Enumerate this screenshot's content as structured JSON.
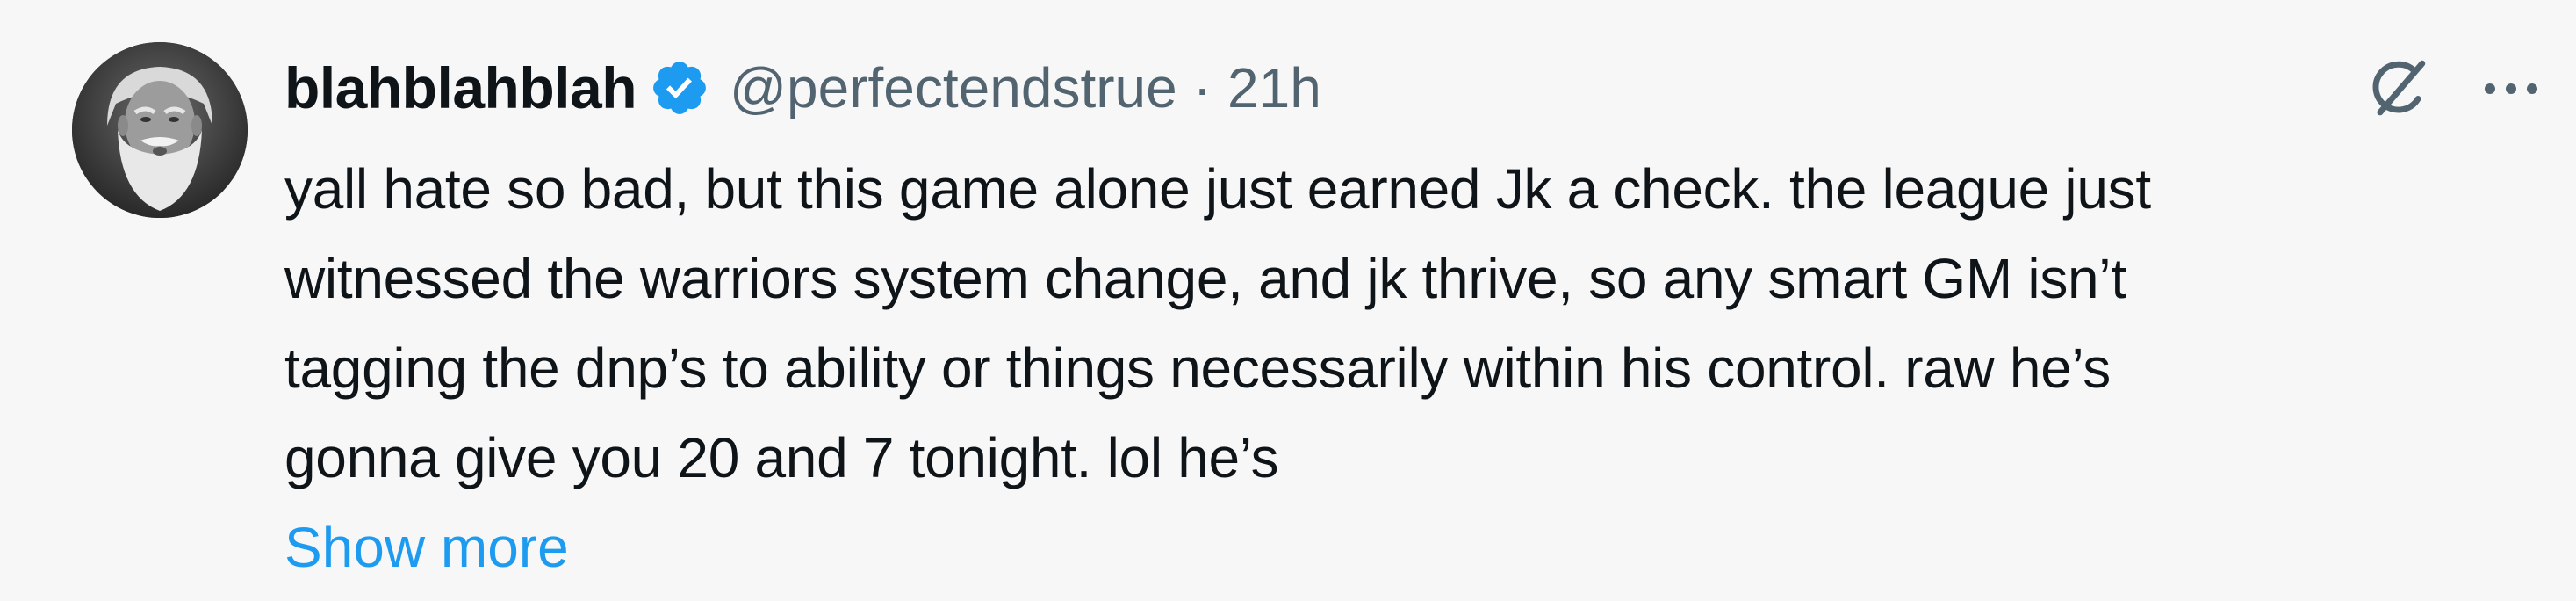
{
  "tweet": {
    "author": {
      "display_name": "blahblahblah",
      "handle": "@perfectendstrue",
      "verified": true,
      "avatar_icon": "avatar-bearded-man"
    },
    "separator": "·",
    "timestamp": "21h",
    "text_lines": [
      "yall hate so bad, but this game alone just earned Jk a check. the league just",
      "witnessed the warriors system change, and jk thrive, so any smart GM isn’t",
      "tagging the dnp’s to ability or things necessarily within his control. raw he’s",
      "gonna give you 20 and 7 tonight. lol he’s"
    ],
    "show_more_label": "Show more",
    "actions": {
      "grok_icon": "grok-icon",
      "more_icon": "more-options-icon"
    }
  },
  "colors": {
    "background": "#f7f7f7",
    "text": "#0f1419",
    "secondary_text": "#536471",
    "link": "#1d9bf0",
    "verified_badge": "#1d9bf0"
  }
}
